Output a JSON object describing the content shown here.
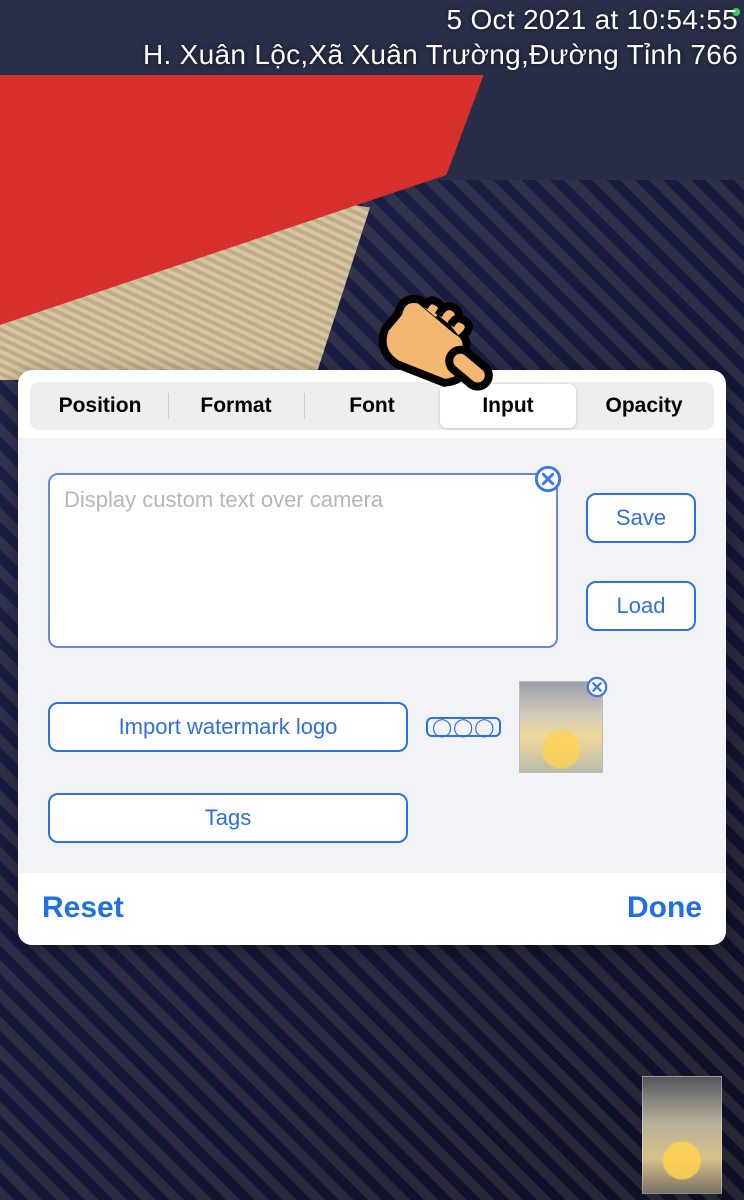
{
  "overlay": {
    "timestamp": "5 Oct 2021 at 10:54:55",
    "location": "H. Xuân Lộc,Xã Xuân Trường,Đường Tỉnh 766"
  },
  "tabs": {
    "position": "Position",
    "format": "Format",
    "font": "Font",
    "input": "Input",
    "opacity": "Opacity",
    "active": "input"
  },
  "input_panel": {
    "placeholder": "Display custom text over camera",
    "value": "",
    "save": "Save",
    "load": "Load",
    "import": "Import watermark logo",
    "tags": "Tags"
  },
  "footer": {
    "reset": "Reset",
    "done": "Done"
  }
}
